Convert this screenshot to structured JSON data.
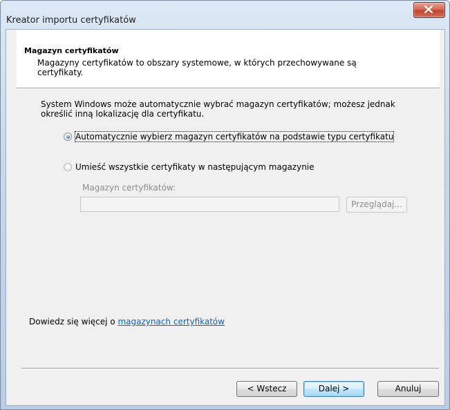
{
  "window": {
    "title": "Kreator importu certyfikatów"
  },
  "header": {
    "title": "Magazyn certyfikatów",
    "description": "Magazyny certyfikatów to obszary systemowe, w których przechowywane są certyfikaty."
  },
  "body": {
    "intro": "System Windows może automatycznie wybrać magazyn certyfikatów; możesz jednak określić inną lokalizację dla certyfikatu.",
    "option_auto": {
      "label": "Automatycznie wybierz magazyn certyfikatów na podstawie typu certyfikatu",
      "checked": true
    },
    "option_manual": {
      "label": "Umieść wszystkie certyfikaty w następującym magazynie",
      "checked": false
    },
    "store_label": "Magazyn certyfikatów:",
    "store_value": "",
    "browse_label": "Przeglądaj..."
  },
  "learn_more": {
    "prefix": "Dowiedz się więcej o ",
    "link": "magazynach certyfikatów"
  },
  "footer": {
    "back_label": "< Wstecz",
    "next_label": "Dalej >",
    "cancel_label": "Anuluj"
  }
}
